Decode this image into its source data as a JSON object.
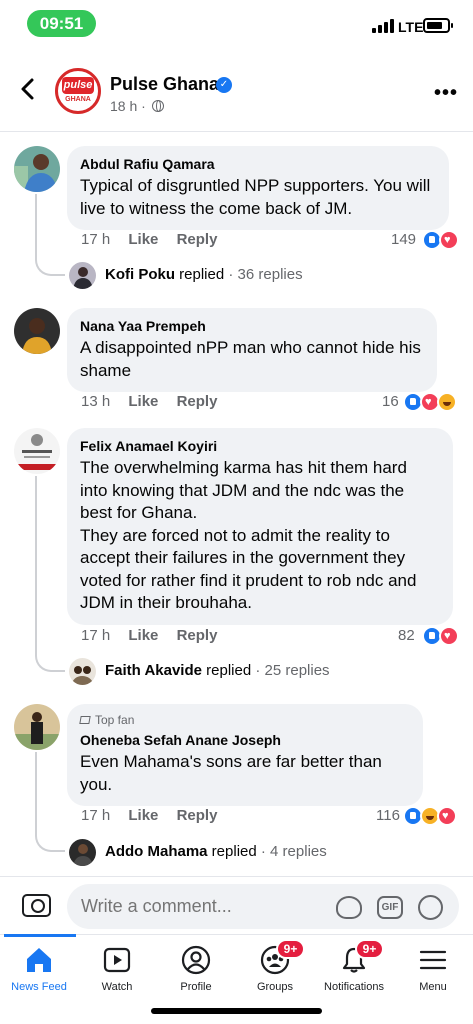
{
  "status_bar": {
    "time": "09:51",
    "network": "LTE"
  },
  "header": {
    "page_name": "Pulse Ghana",
    "logo_top": "pulse",
    "logo_bottom": "GHANA",
    "post_time": "18 h ·"
  },
  "comments": [
    {
      "author": "Abdul Rafiu Qamara",
      "text": "Typical of disgruntled NPP supporters. You will live to witness the come back of JM.",
      "time": "17 h",
      "like_label": "Like",
      "reply_label": "Reply",
      "reaction_count": "149",
      "reactions": [
        "like",
        "love"
      ],
      "replies": {
        "name": "Kofi Poku",
        "verb": " replied",
        "count": " · 36 replies"
      }
    },
    {
      "author": "Nana Yaa Prempeh",
      "text": "A disappointed nPP man who cannot hide his shame",
      "time": "13 h",
      "like_label": "Like",
      "reply_label": "Reply",
      "reaction_count": "16",
      "reactions": [
        "like",
        "love",
        "haha"
      ]
    },
    {
      "author": "Felix Anamael Koyiri",
      "text": "The overwhelming karma has hit them hard into knowing that JDM and the ndc was the best for Ghana.\nThey are forced not to admit the reality to accept their failures in the government they voted for rather find it prudent to rob ndc and JDM in their brouhaha.",
      "time": "17 h",
      "like_label": "Like",
      "reply_label": "Reply",
      "reaction_count": "82",
      "reactions": [
        "like",
        "love"
      ],
      "replies": {
        "name": "Faith Akavide",
        "verb": " replied",
        "count": " · 25 replies"
      }
    },
    {
      "badge": "Top fan",
      "author": "Oheneba Sefah Anane Joseph",
      "text": "Even Mahama's sons are far better than you.",
      "time": "17 h",
      "like_label": "Like",
      "reply_label": "Reply",
      "reaction_count": "116",
      "reactions": [
        "like",
        "haha",
        "love"
      ],
      "replies": {
        "name": "Addo Mahama",
        "verb": " replied",
        "count": " · 4 replies"
      }
    }
  ],
  "composer": {
    "placeholder": "Write a comment...",
    "gif_label": "GIF"
  },
  "nav": {
    "items": [
      {
        "label": "News Feed",
        "icon": "home-icon",
        "active": true
      },
      {
        "label": "Watch",
        "icon": "video-icon"
      },
      {
        "label": "Profile",
        "icon": "profile-icon"
      },
      {
        "label": "Groups",
        "icon": "groups-icon",
        "badge": "9+"
      },
      {
        "label": "Notifications",
        "icon": "bell-icon",
        "badge": "9+"
      },
      {
        "label": "Menu",
        "icon": "menu-icon"
      }
    ]
  },
  "colors": {
    "accent": "#1877f2",
    "bubble": "#f0f2f5",
    "badge": "#e41e3f",
    "time_pill": "#34c759"
  }
}
